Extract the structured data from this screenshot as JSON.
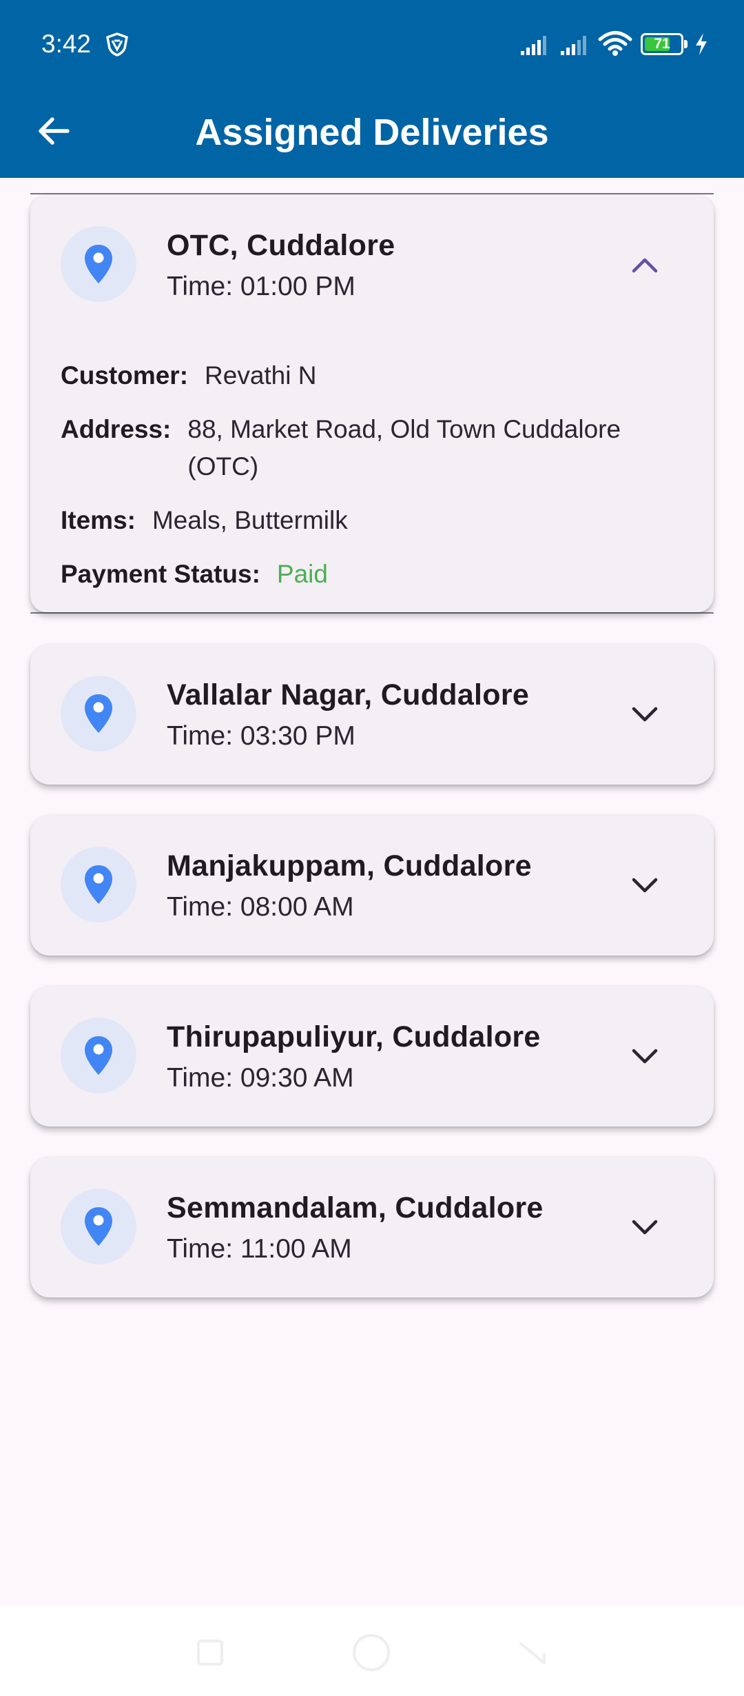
{
  "status_bar": {
    "time": "3:42",
    "battery_level": "71",
    "icons": [
      "vpn-shield-icon",
      "signal-icon",
      "signal-icon",
      "wifi-icon",
      "battery-icon",
      "charging-bolt-icon"
    ]
  },
  "header": {
    "title": "Assigned Deliveries",
    "back_icon": "arrow-left-icon",
    "background_color": "#0064a5"
  },
  "deliveries": [
    {
      "location": "OTC, Cuddalore",
      "time": "Time: 01:00 PM",
      "expanded": true,
      "details": {
        "customer_label": "Customer:",
        "customer": "Revathi N",
        "address_label": "Address:",
        "address": "88, Market Road, Old Town Cuddalore (OTC)",
        "items_label": "Items:",
        "items": "Meals, Buttermilk",
        "payment_label": "Payment Status:",
        "payment_status": "Paid",
        "payment_color": "#4caf50"
      }
    },
    {
      "location": "Vallalar Nagar, Cuddalore",
      "time": "Time: 03:30 PM",
      "expanded": false
    },
    {
      "location": "Manjakuppam, Cuddalore",
      "time": "Time: 08:00 AM",
      "expanded": false
    },
    {
      "location": "Thirupapuliyur, Cuddalore",
      "time": "Time: 09:30 AM",
      "expanded": false
    },
    {
      "location": "Semmandalam, Cuddalore",
      "time": "Time: 11:00 AM",
      "expanded": false
    }
  ],
  "colors": {
    "pin": "#4285f4",
    "pin_background": "#e2e7f8",
    "chevron_expanded": "#6750a4",
    "chevron_collapsed": "#2a2530",
    "card_background": "#f4eff5",
    "page_background": "#fdf7fc"
  }
}
